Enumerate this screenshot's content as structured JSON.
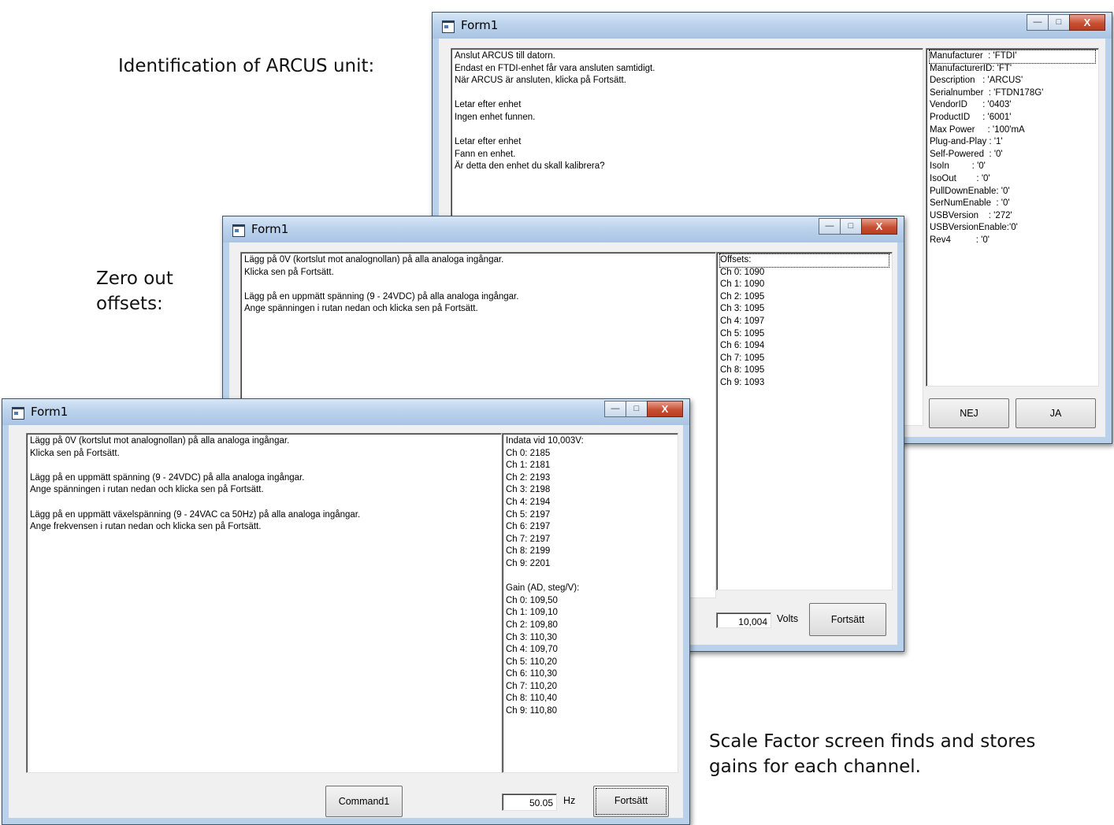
{
  "captions": {
    "identification": "Identification of ARCUS unit:",
    "zero_out": "Zero out offsets:",
    "scale_factor": "Scale Factor screen finds and stores gains for each channel."
  },
  "window_back": {
    "title": "Form1",
    "log_lines": [
      "Anslut ARCUS till datorn.",
      "Endast en FTDI-enhet får vara ansluten samtidigt.",
      "När ARCUS är ansluten, klicka på Fortsätt.",
      "",
      "Letar efter enhet",
      "Ingen enhet funnen.",
      "",
      "Letar efter enhet",
      "Fann en enhet.",
      "Är detta den enhet du skall kalibrera?"
    ],
    "device_info": [
      "Manufacturer  : 'FTDI'",
      "ManufacturerID: 'FT'",
      "Description   : 'ARCUS'",
      "Serialnumber  : 'FTDN178G'",
      "VendorID      : '0403'",
      "ProductID     : '6001'",
      "Max Power     : '100'mA",
      "Plug-and-Play : '1'",
      "Self-Powered  : '0'",
      "IsoIn         : '0'",
      "IsoOut        : '0'",
      "PullDownEnable: '0'",
      "SerNumEnable  : '0'",
      "USBVersion    : '272'",
      "USBVersionEnable:'0'",
      "Rev4          : '0'"
    ],
    "no_button": "NEJ",
    "yes_button": "JA"
  },
  "window_middle": {
    "title": "Form1",
    "log_lines": [
      "Lägg på 0V (kortslut mot analognollan) på alla analoga ingångar.",
      "Klicka sen på Fortsätt.",
      "",
      "Lägg på en uppmätt spänning (9 - 24VDC) på alla analoga ingångar.",
      "Ange spänningen i rutan nedan och klicka sen på Fortsätt."
    ],
    "offsets": [
      "Offsets:",
      "Ch 0: 1090",
      "Ch 1: 1090",
      "Ch 2: 1095",
      "Ch 3: 1095",
      "Ch 4: 1097",
      "Ch 5: 1095",
      "Ch 6: 1094",
      "Ch 7: 1095",
      "Ch 8: 1095",
      "Ch 9: 1093"
    ],
    "volts_value": "10,004",
    "volts_unit": "Volts",
    "continue_button": "Fortsätt"
  },
  "window_front": {
    "title": "Form1",
    "log_lines": [
      "Lägg på 0V (kortslut mot analognollan) på alla analoga ingångar.",
      "Klicka sen på Fortsätt.",
      "",
      "Lägg på en uppmätt spänning (9 - 24VDC) på alla analoga ingångar.",
      "Ange spänningen i rutan nedan och klicka sen på Fortsätt.",
      "",
      "Lägg på en uppmätt växelspänning (9 - 24VAC ca 50Hz) på alla analoga ingångar.",
      "Ange frekvensen i rutan nedan och klicka sen på Fortsätt."
    ],
    "gain_data": [
      "Indata vid 10,003V:",
      "Ch 0: 2185",
      "Ch 1: 2181",
      "Ch 2: 2193",
      "Ch 3: 2198",
      "Ch 4: 2194",
      "Ch 5: 2197",
      "Ch 6: 2197",
      "Ch 7: 2197",
      "Ch 8: 2199",
      "Ch 9: 2201",
      "",
      "Gain (AD, steg/V):",
      "Ch 0: 109,50",
      "Ch 1: 109,10",
      "Ch 2: 109,80",
      "Ch 3: 110,30",
      "Ch 4: 109,70",
      "Ch 5: 110,20",
      "Ch 6: 110,30",
      "Ch 7: 110,20",
      "Ch 8: 110,40",
      "Ch 9: 110,80"
    ],
    "command_button": "Command1",
    "hz_value": "50.05",
    "hz_unit": "Hz",
    "continue_button": "Fortsätt"
  },
  "titlebar_controls": {
    "minimize": "—",
    "maximize": "□",
    "close": "X"
  },
  "colors": {
    "frame": "#b9d1ea",
    "client": "#f0f0f0",
    "close_button": "#c75033"
  }
}
